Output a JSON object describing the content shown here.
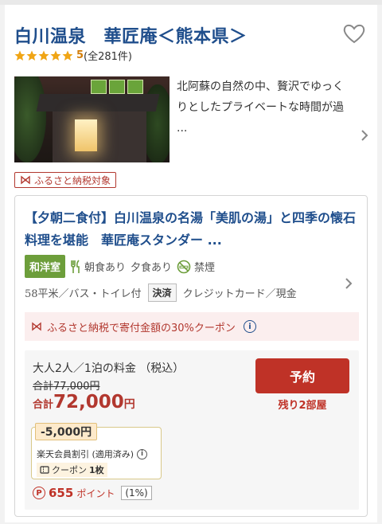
{
  "hotel": {
    "name": "白川温泉　華匠庵＜熊本県＞",
    "rating_value": "5",
    "rating_count": "(全281件)",
    "description": "北阿蘇の自然の中、贅沢でゆっくりとしたプライベートな時間が過 ...",
    "furusato_tag": "ふるさと納税対象"
  },
  "icons": {
    "favorite": "heart-outline-icon",
    "star": "star-icon",
    "chevron": "chevron-right-icon",
    "gift": "ribbon-icon",
    "info": "info-icon",
    "coupon": "coupon-icon",
    "points": "points-icon"
  },
  "colors": {
    "title_blue": "#1f4e8c",
    "accent_red": "#bf3227",
    "rating_orange": "#d37e0a",
    "room_green": "#6d9e3b",
    "banner_bg": "#fbeeee"
  },
  "plan": {
    "title": "【夕朝二食付】白川温泉の名湯「美肌の湯」と四季の懐石料理を堪能　華匠庵スタンダー ...",
    "room_type": "和洋室",
    "breakfast": "朝食あり",
    "dinner": "夕食あり",
    "smoking": "禁煙",
    "room_spec": "58平米／バス・トイレ付",
    "settlement_badge": "決済",
    "settlement_methods": "クレジットカード／現金",
    "coupon_banner": "ふるさと納税で寄付金額の30%クーポン",
    "price": {
      "condition": "大人2人／1泊の料金 （税込）",
      "original": "合計77,000円",
      "final_label": "合計",
      "final_amount": "72,000",
      "final_unit": "円"
    },
    "book_button": "予約",
    "rooms_left": "残り2部屋",
    "discount": {
      "amount": "-5,000円",
      "name": "楽天会員割引 (適用済み)",
      "coupon_label": "クーポン",
      "coupon_count": "1枚"
    },
    "points": {
      "value": "655",
      "label": "ポイント",
      "rate": "(1%)"
    }
  }
}
